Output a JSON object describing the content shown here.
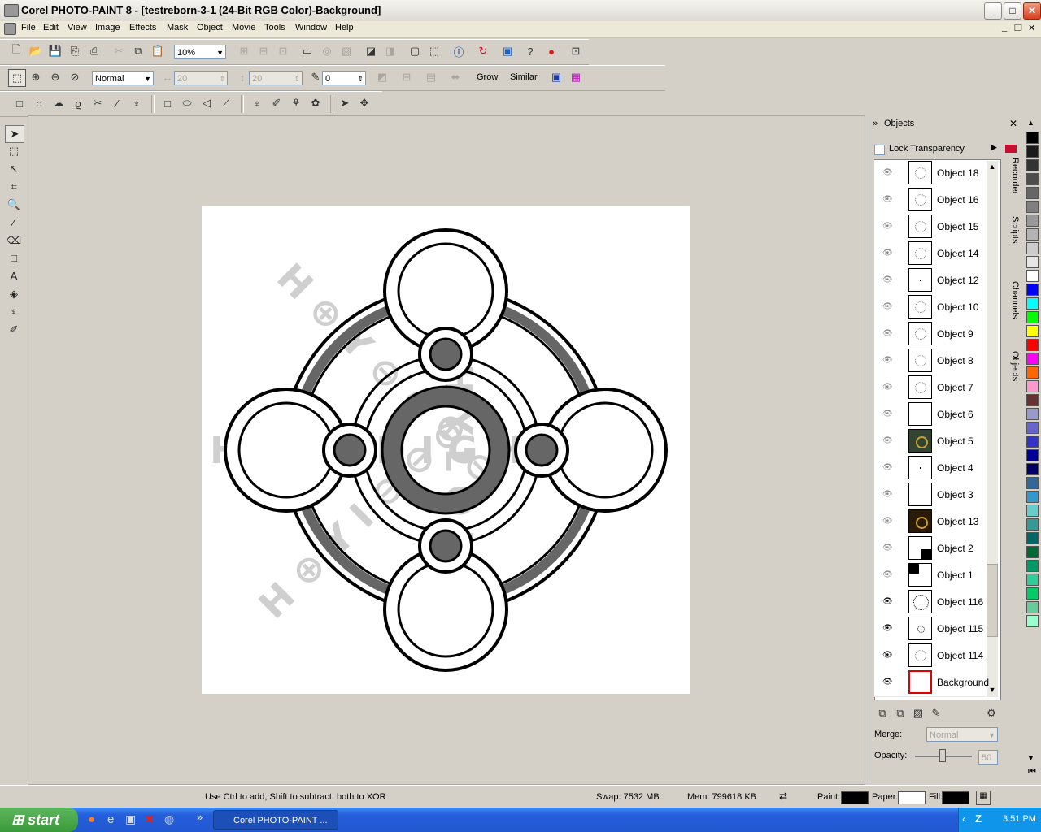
{
  "window": {
    "title": "Corel PHOTO-PAINT 8 - [testreborn-3-1  (24-Bit RGB Color)-Background]",
    "min": "_",
    "max": "□",
    "close": "✕"
  },
  "menu": [
    "File",
    "Edit",
    "View",
    "Image",
    "Effects",
    "Mask",
    "Object",
    "Movie",
    "Tools",
    "Window",
    "Help"
  ],
  "toolbar": {
    "zoom": "10%",
    "mode": "Normal",
    "width_value": "20",
    "height_value": "20",
    "angle_value": "0",
    "grow_label": "Grow",
    "similar_label": "Similar"
  },
  "docker": {
    "title": "Objects",
    "lock_transparency": "Lock Transparency",
    "merge_label": "Merge:",
    "merge_value": "Normal",
    "opacity_label": "Opacity:",
    "opacity_value": "50",
    "objects": [
      {
        "name": "Object 18",
        "visible": false
      },
      {
        "name": "Object 16",
        "visible": false
      },
      {
        "name": "Object 15",
        "visible": false
      },
      {
        "name": "Object 14",
        "visible": false
      },
      {
        "name": "Object 12",
        "visible": false
      },
      {
        "name": "Object 10",
        "visible": false
      },
      {
        "name": "Object 9",
        "visible": false
      },
      {
        "name": "Object 8",
        "visible": false
      },
      {
        "name": "Object 7",
        "visible": false
      },
      {
        "name": "Object 6",
        "visible": false
      },
      {
        "name": "Object 5",
        "visible": false
      },
      {
        "name": "Object 4",
        "visible": false
      },
      {
        "name": "Object 3",
        "visible": false
      },
      {
        "name": "Object 13",
        "visible": false
      },
      {
        "name": "Object 2",
        "visible": false
      },
      {
        "name": "Object 1",
        "visible": false
      },
      {
        "name": "Object 116",
        "visible": true
      },
      {
        "name": "Object 115",
        "visible": true
      },
      {
        "name": "Object 114",
        "visible": true
      },
      {
        "name": "Background",
        "visible": true
      }
    ],
    "side_tabs": [
      "Recorder",
      "Scripts",
      "Channels",
      "Objects"
    ]
  },
  "palette": [
    "#000000",
    "#1a1a1a",
    "#333333",
    "#4d4d4d",
    "#666666",
    "#808080",
    "#999999",
    "#b3b3b3",
    "#cccccc",
    "#e6e6e6",
    "#ffffff",
    "#0000ff",
    "#00ffff",
    "#00ff00",
    "#ffff00",
    "#ff0000",
    "#ff00ff",
    "#ff6600",
    "#ff99cc",
    "#663333",
    "#9999cc",
    "#6666cc",
    "#3333cc",
    "#000099",
    "#000066",
    "#336699",
    "#3399cc",
    "#66cccc",
    "#339999",
    "#006666",
    "#006633",
    "#009966",
    "#33cc99",
    "#00cc66",
    "#66cc99",
    "#99ffcc"
  ],
  "status": {
    "hint": "Use Ctrl to add, Shift to subtract, both to XOR",
    "swap": "Swap: 7532 MB",
    "mem": "Mem: 799618 KB",
    "paint": "Paint:",
    "paper": "Paper:",
    "fill": "Fill:"
  },
  "taskbar": {
    "start": "start",
    "task": "Corel PHOTO-PAINT ...",
    "clock": "3:51 PM"
  },
  "canvas_text": "HOLY NIGHT"
}
